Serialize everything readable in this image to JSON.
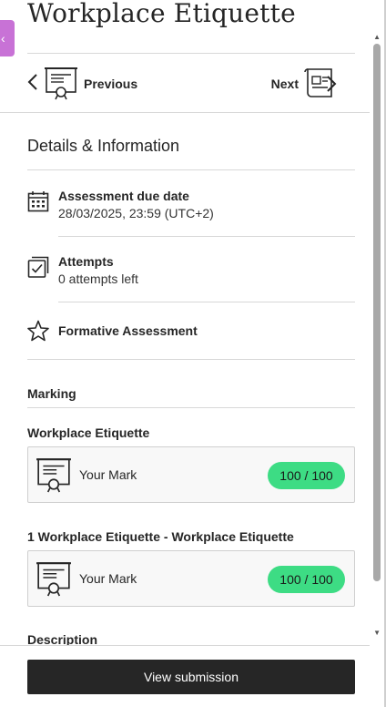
{
  "header": {
    "title": "Workplace Etiquette",
    "back_glyph": "‹"
  },
  "nav": {
    "previous_label": "Previous",
    "next_label": "Next"
  },
  "details": {
    "section_title": "Details & Information",
    "due": {
      "label": "Assessment due date",
      "value": "28/03/2025, 23:59 (UTC+2)",
      "icon": "calendar-icon"
    },
    "attempts": {
      "label": "Attempts",
      "value": "0 attempts left",
      "icon": "attempts-icon"
    },
    "formative": {
      "label": "Formative Assessment",
      "icon": "star-icon"
    }
  },
  "marking": {
    "title": "Marking",
    "items": [
      {
        "title": "Workplace Etiquette",
        "your_mark": "Your Mark",
        "score": "100 / 100"
      },
      {
        "title": "1 Workplace Etiquette - Workplace Etiquette",
        "your_mark": "Your Mark",
        "score": "100 / 100"
      }
    ]
  },
  "description": {
    "title": "Description"
  },
  "footer": {
    "view_submission": "View submission"
  },
  "colors": {
    "accent_purple": "#c872d6",
    "score_badge": "#3ddc84",
    "button_dark": "#262626"
  }
}
